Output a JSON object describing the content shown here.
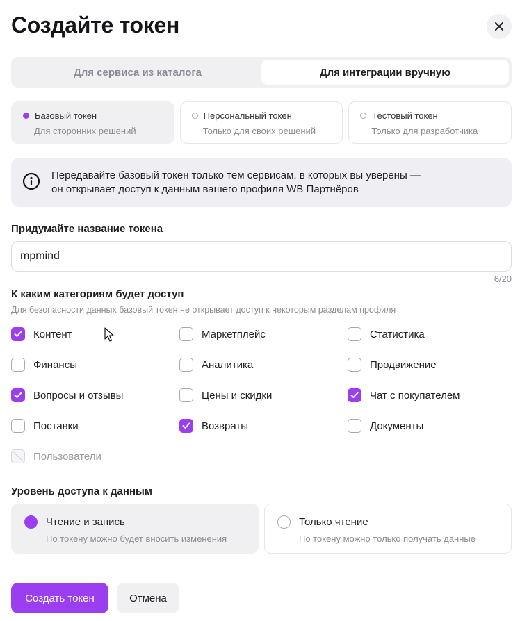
{
  "dialog": {
    "title": "Создайте токен",
    "close_icon": "close-icon"
  },
  "mode_tabs": [
    {
      "label": "Для сервиса из каталога",
      "active": false
    },
    {
      "label": "Для интеграции вручную",
      "active": true
    }
  ],
  "token_types": [
    {
      "title": "Базовый токен",
      "subtitle": "Для сторонних решений",
      "selected": true
    },
    {
      "title": "Персональный токен",
      "subtitle": "Только для своих решений",
      "selected": false
    },
    {
      "title": "Тестовый токен",
      "subtitle": "Только для разработчика",
      "selected": false
    }
  ],
  "info": {
    "icon": "info-icon",
    "line1": "Передавайте базовый токен только тем сервисам, в которых вы уверены —",
    "line2": "он открывает доступ к данным вашего профиля WB Партнёров"
  },
  "name_field": {
    "label": "Придумайте название токена",
    "value": "mpmind",
    "counter": "6/20"
  },
  "categories_section": {
    "label": "К каким категориям будет доступ",
    "hint": "Для безопасности данных базовый токен не открывает доступ к некоторым разделам профиля",
    "items": [
      {
        "label": "Контент",
        "checked": true,
        "disabled": false
      },
      {
        "label": "Маркетплейс",
        "checked": false,
        "disabled": false
      },
      {
        "label": "Статистика",
        "checked": false,
        "disabled": false
      },
      {
        "label": "Финансы",
        "checked": false,
        "disabled": false
      },
      {
        "label": "Аналитика",
        "checked": false,
        "disabled": false
      },
      {
        "label": "Продвижение",
        "checked": false,
        "disabled": false
      },
      {
        "label": "Вопросы и отзывы",
        "checked": true,
        "disabled": false
      },
      {
        "label": "Цены и скидки",
        "checked": false,
        "disabled": false
      },
      {
        "label": "Чат с покупателем",
        "checked": true,
        "disabled": false
      },
      {
        "label": "Поставки",
        "checked": false,
        "disabled": false
      },
      {
        "label": "Возвраты",
        "checked": true,
        "disabled": false
      },
      {
        "label": "Документы",
        "checked": false,
        "disabled": false
      },
      {
        "label": "Пользователи",
        "checked": false,
        "disabled": true
      }
    ]
  },
  "access_level": {
    "label": "Уровень доступа к данным",
    "options": [
      {
        "title": "Чтение и запись",
        "subtitle": "По токену можно будет вносить изменения",
        "selected": true
      },
      {
        "title": "Только чтение",
        "subtitle": "По токену можно только получать данные",
        "selected": false
      }
    ]
  },
  "actions": {
    "create_label": "Создать токен",
    "cancel_label": "Отмена"
  },
  "colors": {
    "accent": "#9b3ef0",
    "muted_bg": "#f0f0f3"
  }
}
